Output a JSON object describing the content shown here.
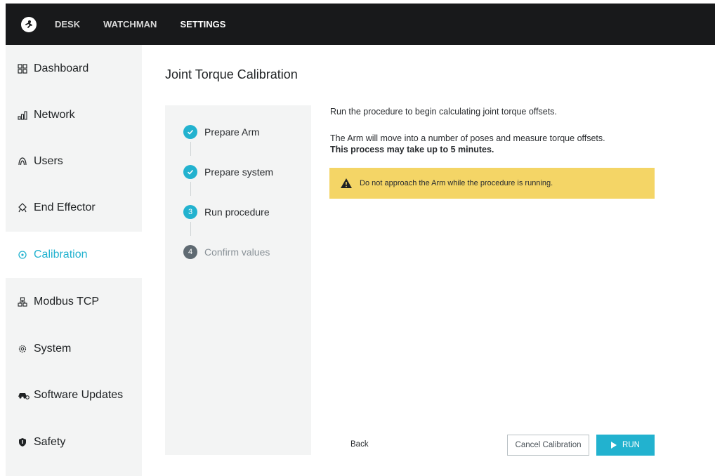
{
  "topnav": {
    "items": [
      {
        "label": "DESK",
        "active": false
      },
      {
        "label": "WATCHMAN",
        "active": false
      },
      {
        "label": "SETTINGS",
        "active": true
      }
    ]
  },
  "sidebar": {
    "items": [
      {
        "label": "Dashboard",
        "icon": "dashboard-icon"
      },
      {
        "label": "Network",
        "icon": "network-icon"
      },
      {
        "label": "Users",
        "icon": "users-icon"
      },
      {
        "label": "End Effector",
        "icon": "end-effector-icon"
      },
      {
        "label": "Calibration",
        "icon": "calibration-icon",
        "active": true
      },
      {
        "label": "Modbus TCP",
        "icon": "modbus-icon"
      },
      {
        "label": "System",
        "icon": "gear-icon"
      },
      {
        "label": "Software Updates",
        "icon": "software-updates-icon"
      },
      {
        "label": "Safety",
        "icon": "shield-icon"
      }
    ]
  },
  "page": {
    "title": "Joint Torque Calibration"
  },
  "steps": [
    {
      "label": "Prepare Arm",
      "state": "done",
      "marker": ""
    },
    {
      "label": "Prepare system",
      "state": "done",
      "marker": ""
    },
    {
      "label": "Run procedure",
      "state": "current",
      "marker": "3"
    },
    {
      "label": "Confirm values",
      "state": "todo",
      "marker": "4"
    }
  ],
  "content": {
    "intro": "Run the procedure to begin calculating joint torque offsets.",
    "description": "The Arm will move into a number of poses and measure torque offsets.",
    "duration_note": "This process may take up to 5 minutes.",
    "warning": "Do not approach the Arm while the procedure is running."
  },
  "actions": {
    "back_label": "Back",
    "cancel_label": "Cancel Calibration",
    "run_label": "RUN"
  },
  "colors": {
    "accent": "#22b2cf",
    "warning_bg": "#f4d566",
    "topbar_bg": "#18191b"
  }
}
